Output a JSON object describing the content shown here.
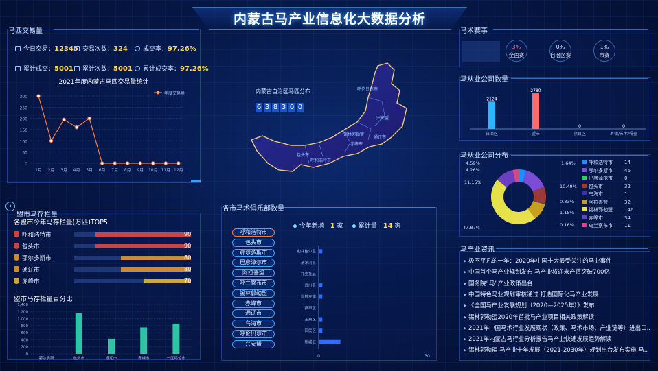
{
  "header": {
    "title": "内蒙古马产业信息化大数据分析"
  },
  "trade": {
    "title": "马匹交易量",
    "stats": [
      {
        "label": "今日交易：",
        "value": "12345"
      },
      {
        "label": "交易次数：",
        "value": "324"
      },
      {
        "label": "成交率：",
        "value": "97.26%"
      },
      {
        "label": "累计成交：",
        "value": "5001"
      },
      {
        "label": "累计次数：",
        "value": "5001"
      },
      {
        "label": "累计成交率：",
        "value": "97.26%"
      }
    ]
  },
  "map_panel": {
    "label": "内蒙古自治区马匹分布",
    "counter": [
      "6",
      "3",
      "8",
      "3",
      "0",
      "0"
    ]
  },
  "events": {
    "title": "马术赛事",
    "items": [
      {
        "value": "3%",
        "label": "全国赛"
      },
      {
        "value": "0%",
        "label": "自治区赛"
      },
      {
        "value": "1%",
        "label": "市赛"
      }
    ]
  },
  "company_count": {
    "title": "马从业公司数量"
  },
  "company_dist": {
    "title": "马从业公司分布",
    "pct_labels": [
      "4.59%",
      "4.26%",
      "11.15%",
      "47.87%",
      "1.64%",
      "10.49%",
      "0.33%",
      "1.15%",
      "0.16%"
    ],
    "legend": [
      {
        "name": "呼和浩特市",
        "value": "14",
        "color": "#1e8fff"
      },
      {
        "name": "鄂尔多斯市",
        "value": "46",
        "color": "#7b4dd6"
      },
      {
        "name": "巴彦淖尔市",
        "value": "0",
        "color": "#2ecc71"
      },
      {
        "name": "包头市",
        "value": "32",
        "color": "#9b3a3a"
      },
      {
        "name": "乌海市",
        "value": "1",
        "color": "#3d2fb0"
      },
      {
        "name": "阿拉善盟",
        "value": "32",
        "color": "#c8a020"
      },
      {
        "name": "锡林郭勒盟",
        "value": "146",
        "color": "#e6e04a"
      },
      {
        "name": "赤峰市",
        "value": "34",
        "color": "#6a3fc0"
      },
      {
        "name": "乌兰察布市",
        "value": "11",
        "color": "#d04a8a"
      }
    ]
  },
  "news": {
    "title": "马产业资讯",
    "items": [
      "极不平凡的一年：2020年中国十大最受关注的马业事件",
      "中国首个马产业规划发布 马产业将迎来产值突破700亿",
      "国务院“马”产业政策出台",
      "中国特色马业规划审核通过 打造国际化马产业发展",
      "《全国马产业发展规划（2020—2025年）》发布",
      "锡林郭勒盟2020年首批马产业项目相关政策解读",
      "2021年中国马术行业发展现状（政策、马术市场、产业链等）进出口..",
      "2021年内蒙古马行业分析报告马产业快速发展趋势解读",
      "锡林郭勒盟 马产业十年发展（2021-2030年）规划出台发布实施 马.."
    ]
  },
  "stock": {
    "title": "盟市马存栏量",
    "subtitle": "各盟市今年马存栏量(万匹)TOP5",
    "ranks": [
      {
        "name": "呼和浩特市",
        "value": "90",
        "color": "#c74545",
        "pct": 0.82
      },
      {
        "name": "包头市",
        "value": "90",
        "color": "#c74545",
        "pct": 0.82
      },
      {
        "name": "鄂尔多斯市",
        "value": "80",
        "color": "#c98a3a",
        "pct": 0.6
      },
      {
        "name": "通辽市",
        "value": "80",
        "color": "#c98a3a",
        "pct": 0.6
      },
      {
        "name": "赤峰市",
        "value": "70",
        "color": "#c7a845",
        "pct": 0.4
      }
    ],
    "bar_title": "盟市马存栏量百分比"
  },
  "club": {
    "title": "各市马术俱乐部数量",
    "new_label": "今年新增",
    "new_value": "1",
    "new_unit": "家",
    "total_label": "累计量",
    "total_value": "14",
    "total_unit": "家",
    "cities": [
      "呼和浩特市",
      "包头市",
      "鄂尔多斯市",
      "巴彦淖尔市",
      "阿拉善盟",
      "呼兰察布市",
      "锡林郭勒盟",
      "赤峰市",
      "通辽市",
      "乌海市",
      "呼伦贝尔市",
      "兴安盟"
    ]
  },
  "chart_data": [
    {
      "type": "line",
      "title": "2021年度内蒙古马匹交易量统计",
      "legend": "年度交易量",
      "categories": [
        "1月",
        "2月",
        "3月",
        "4月",
        "5月",
        "6月",
        "7月",
        "8月",
        "9月",
        "10月",
        "11月",
        "12月"
      ],
      "values": [
        300,
        100,
        195,
        160,
        200,
        0,
        0,
        0,
        0,
        0,
        0,
        0
      ],
      "ylim": [
        0,
        300
      ],
      "yticks": [
        "0",
        "50",
        "100",
        "150",
        "200",
        "250",
        "300"
      ]
    },
    {
      "type": "bar",
      "categories": [
        "自治区",
        "盟市",
        "旗县区",
        "乡镇/苏木/嘎查"
      ],
      "values": [
        2124,
        2780,
        0,
        0
      ],
      "ylim": [
        0,
        3000
      ]
    },
    {
      "type": "bar",
      "title": "盟市马存栏量百分比",
      "categories": [
        "鄂尔多斯",
        "包头市",
        "通辽市",
        "赤峰市",
        "一区呼伦市"
      ],
      "values": [
        0,
        1150,
        430,
        750,
        850
      ],
      "ylim": [
        0,
        1400
      ],
      "yticks": [
        "0",
        "200",
        "400",
        "600",
        "800",
        "1,000",
        "1,200",
        "1,400"
      ]
    },
    {
      "type": "bar",
      "orientation": "horizontal",
      "categories": [
        "和林格尔县",
        "清水河县",
        "托克托县",
        "武川县",
        "土默特左旗",
        "赛罕区",
        "玉泉区",
        "回民区",
        "新城区"
      ],
      "values": [
        1,
        0,
        0,
        1,
        1,
        0,
        1,
        1,
        6
      ],
      "xlim": [
        0,
        30
      ],
      "xticks": [
        "0",
        "30"
      ]
    },
    {
      "type": "pie",
      "labels": [
        "呼和浩特市",
        "鄂尔多斯市",
        "巴彦淖尔市",
        "包头市",
        "乌海市",
        "阿拉善盟",
        "锡林郭勒盟",
        "赤峰市",
        "乌兰察布市"
      ],
      "values": [
        14,
        46,
        0,
        32,
        1,
        32,
        146,
        34,
        11
      ]
    }
  ]
}
